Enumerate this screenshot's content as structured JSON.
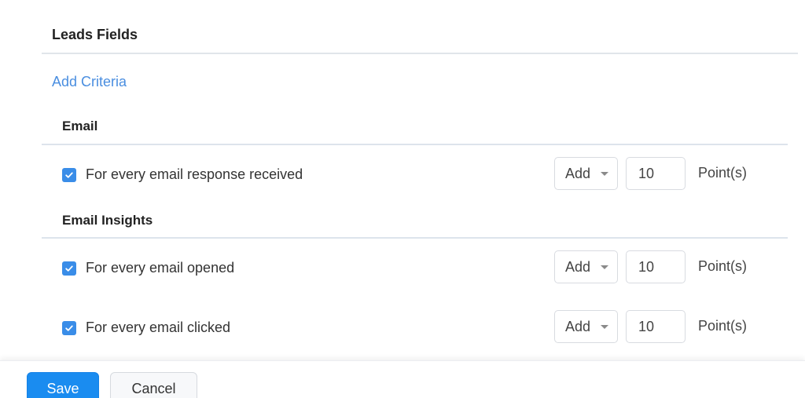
{
  "module_title": "Leads Fields",
  "add_criteria_label": "Add Criteria",
  "colors": {
    "accent": "#1a8cf0",
    "link": "#4a8ee0",
    "checkbox": "#3a8de8"
  },
  "sections": [
    {
      "title": "Email",
      "rules": [
        {
          "label": "For every email response received",
          "checked": true,
          "operator": "Add",
          "points": "10",
          "unit": "Point(s)"
        }
      ]
    },
    {
      "title": "Email Insights",
      "rules": [
        {
          "label": "For every email opened",
          "checked": true,
          "operator": "Add",
          "points": "10",
          "unit": "Point(s)"
        },
        {
          "label": "For every email clicked",
          "checked": true,
          "operator": "Add",
          "points": "10",
          "unit": "Point(s)"
        }
      ]
    }
  ],
  "footer": {
    "save_label": "Save",
    "cancel_label": "Cancel"
  }
}
